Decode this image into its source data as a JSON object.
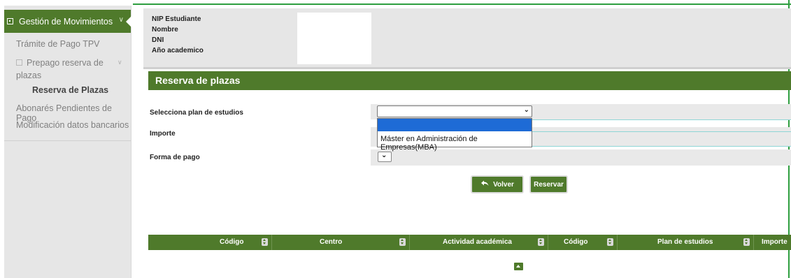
{
  "sidebar": {
    "section_title": "Gestión de Movimientos",
    "items": [
      {
        "label": "Trámite de Pago TPV"
      },
      {
        "label_line1": "Prepago reserva de",
        "label_line2": "plazas"
      },
      {
        "label": "Reserva de Plazas"
      },
      {
        "label": "Abonarés Pendientes de Pago"
      },
      {
        "label": "Modificación datos bancarios"
      }
    ]
  },
  "info": {
    "labels": [
      "NIP Estudiante",
      "Nombre",
      "DNI",
      "Año academico"
    ]
  },
  "section": {
    "title": "Reserva de plazas"
  },
  "form": {
    "plan_label": "Selecciona plan de estudios",
    "importe_label": "Importe",
    "forma_pago_label": "Forma de pago",
    "plan_selected_value": "",
    "plan_options": [
      "",
      "Máster en Administración de Empresas(MBA)"
    ]
  },
  "buttons": {
    "volver": "Volver",
    "reservar": "Reservar"
  },
  "table": {
    "columns": [
      "Código",
      "Centro",
      "Actividad académica",
      "Código",
      "Plan de estudios",
      "Importe"
    ]
  },
  "colors": {
    "accent_green": "#4f7a2b",
    "highlight_blue": "#1e6bd6"
  }
}
